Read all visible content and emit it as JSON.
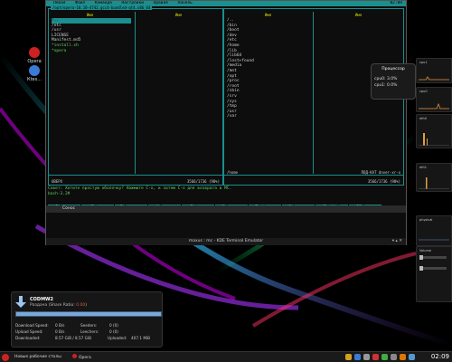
{
  "desktop": {
    "icons": [
      {
        "label": "Opera",
        "color": "#c22"
      },
      {
        "label": "Кtes...",
        "color": "#3a7bd5"
      }
    ]
  },
  "terminal": {
    "menubar": [
      "Левая",
      "Файл",
      "Команда",
      "Настройки",
      "Правая",
      "Панель"
    ],
    "clock": "02:09",
    "left_panel": {
      "path": "/opt/opera-10.10-4742.gcc4-bundled-qt4.x86_64",
      "col_header_1": "Имя",
      "col_header_2": "Имя",
      "items": [
        "/..",
        "/etc",
        "/usr",
        "LICENSE",
        "Manifest.md5",
        "*install.sh",
        "*opera"
      ],
      "footer_left": "UBEPX",
      "footer_right": "3566/1736 (90%)"
    },
    "right_panel": {
      "col_header_1": "Имя",
      "col_header_2": "Имя",
      "items": [
        "/..",
        "/bin",
        "/boot",
        "/dev",
        "/etc",
        "/home",
        "/lib",
        "/lib64",
        "/lost+found",
        "/media",
        "/mnt",
        "/opt",
        "/proc",
        "/root",
        "/sbin",
        "/srv",
        "/sys",
        "/tmp",
        "/usr",
        "/var"
      ],
      "footer_left": "/home",
      "footer_mid": "ПОД-КАТ dnver-xr-x",
      "footer_right": "3566/1736 (90%)"
    },
    "command_lines": [
      "Совет: Хотите простую оболочку? Нажмите C-o, и затем C-o для возврата в MC.",
      "bash-3.2# "
    ],
    "fkeys": [
      {
        "num": "1",
        "label": "Помощь"
      },
      {
        "num": "2",
        "label": "Меню"
      },
      {
        "num": "3",
        "label": "Просмотр"
      },
      {
        "num": "4",
        "label": "Правка"
      },
      {
        "num": "5",
        "label": "Копия"
      },
      {
        "num": "6",
        "label": "Перенос"
      },
      {
        "num": "7",
        "label": "НвКтлог"
      },
      {
        "num": "8",
        "label": "Удалить"
      },
      {
        "num": "9",
        "label": "МенюМС"
      },
      {
        "num": "10",
        "label": "Выход"
      }
    ],
    "tab_label": "Сонос",
    "title": "maxus : mc - KDE Terminal Emulator"
  },
  "tooltip": {
    "title": "Процессор",
    "rows": [
      "cpu0: 3.0%",
      "cpu1: 0.0%"
    ]
  },
  "widgets": [
    {
      "label": "cpu1"
    },
    {
      "label": "cpu0"
    },
    {
      "label": "eth0"
    },
    {
      "label": "eth1"
    },
    {
      "label": "physical"
    },
    {
      "label": "Volume"
    }
  ],
  "download": {
    "filename": "CODMW2",
    "status_prefix": "Раздача (Share Ratio: ",
    "ratio": "0.00",
    "status_suffix": ")",
    "progress": 1.0,
    "rows": [
      [
        "Download Speed:",
        "0 B/s",
        "Seeders:",
        "0 (0)"
      ],
      [
        "Upload Speed:",
        "0 B/s",
        "Leechers:",
        "0 (0)"
      ],
      [
        "Downloaded:",
        "8.57 GiB / 8.57 GiB",
        "Uploaded:",
        "407.1 MiB"
      ]
    ]
  },
  "taskbar": {
    "task_left": "Новые рабочие столы",
    "task_opera": "Opera",
    "clock": "02:09"
  }
}
